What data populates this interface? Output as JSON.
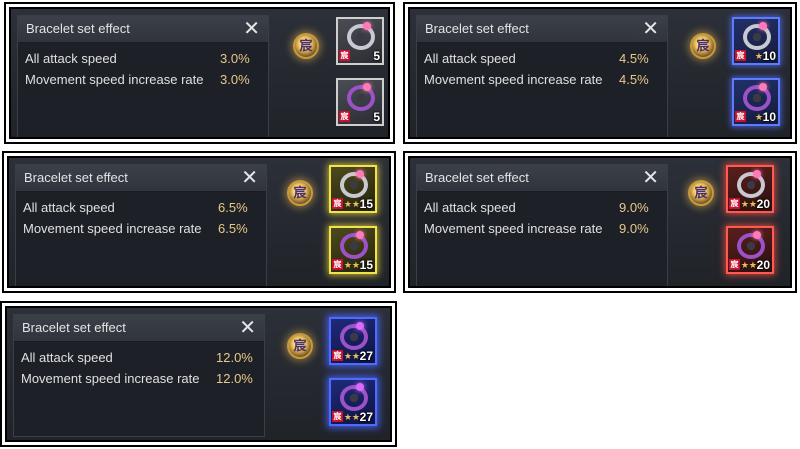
{
  "panels": [
    {
      "title": "Bracelet set effect",
      "close": "✕",
      "stats": [
        {
          "label": "All attack speed",
          "value": "3.0%"
        },
        {
          "label": "Movement speed increase rate",
          "value": "3.0%"
        }
      ],
      "emblem": "宸",
      "slots": [
        {
          "stars": "",
          "level": "5"
        },
        {
          "stars": "",
          "level": "5"
        }
      ],
      "tier_color": "#cfcfcf"
    },
    {
      "title": "Bracelet set effect",
      "close": "✕",
      "stats": [
        {
          "label": "All attack speed",
          "value": "4.5%"
        },
        {
          "label": "Movement speed increase rate",
          "value": "4.5%"
        }
      ],
      "emblem": "宸",
      "slots": [
        {
          "stars": "★",
          "level": "10"
        },
        {
          "stars": "★",
          "level": "10"
        }
      ],
      "tier_color": "#5c7cff"
    },
    {
      "title": "Bracelet set effect",
      "close": "✕",
      "stats": [
        {
          "label": "All attack speed",
          "value": "6.5%"
        },
        {
          "label": "Movement speed increase rate",
          "value": "6.5%"
        }
      ],
      "emblem": "宸",
      "slots": [
        {
          "stars": "★★",
          "level": "15"
        },
        {
          "stars": "★★",
          "level": "15"
        }
      ],
      "tier_color": "#f1e34a"
    },
    {
      "title": "Bracelet set effect",
      "close": "✕",
      "stats": [
        {
          "label": "All attack speed",
          "value": "9.0%"
        },
        {
          "label": "Movement speed increase rate",
          "value": "9.0%"
        }
      ],
      "emblem": "宸",
      "slots": [
        {
          "stars": "★★",
          "level": "20"
        },
        {
          "stars": "★★",
          "level": "20"
        }
      ],
      "tier_color": "#ff5a4d"
    },
    {
      "title": "Bracelet set effect",
      "close": "✕",
      "stats": [
        {
          "label": "All attack speed",
          "value": "12.0%"
        },
        {
          "label": "Movement speed increase rate",
          "value": "12.0%"
        }
      ],
      "emblem": "宸",
      "slots": [
        {
          "stars": "★★",
          "level": "27"
        },
        {
          "stars": "★★",
          "level": "27"
        }
      ],
      "tier_color": "#4d6bff"
    }
  ],
  "item_badge": "宸",
  "icons": {
    "close": "close-icon",
    "emblem": "set-emblem-icon",
    "item": "bracelet-icon"
  }
}
